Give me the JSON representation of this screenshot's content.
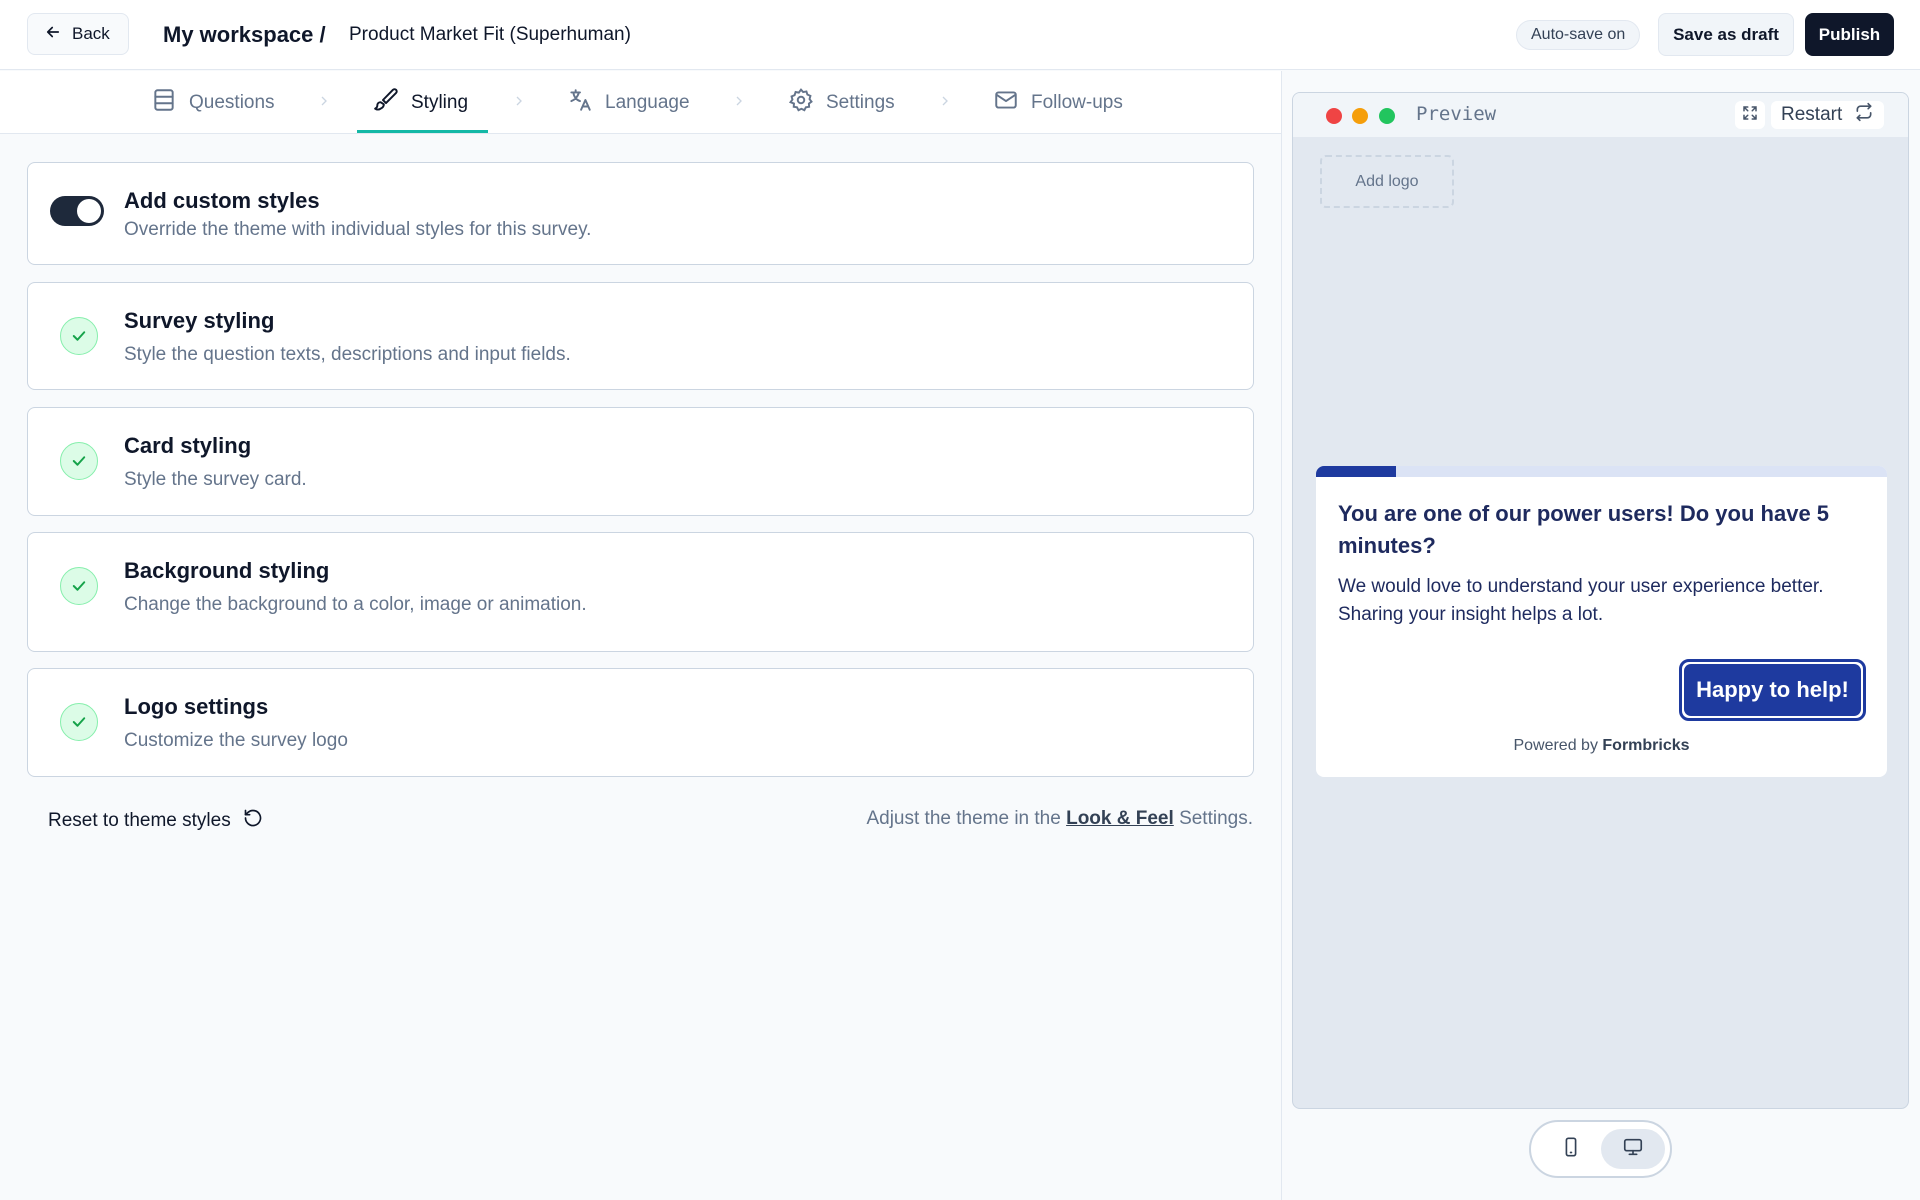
{
  "header": {
    "back_label": "Back",
    "workspace": "My workspace /",
    "survey_name": "Product Market Fit (Superhuman)",
    "autosave": "Auto-save on",
    "save_draft": "Save as draft",
    "publish": "Publish"
  },
  "tabs": [
    {
      "label": "Questions",
      "icon": "questions-icon",
      "active": false
    },
    {
      "label": "Styling",
      "icon": "paintbrush-icon",
      "active": true
    },
    {
      "label": "Language",
      "icon": "language-icon",
      "active": false
    },
    {
      "label": "Settings",
      "icon": "gear-icon",
      "active": false
    },
    {
      "label": "Follow-ups",
      "icon": "mail-icon",
      "active": false
    }
  ],
  "custom_styles": {
    "title": "Add custom styles",
    "desc": "Override the theme with individual styles for this survey.",
    "enabled": true
  },
  "sections": [
    {
      "title": "Survey styling",
      "desc": "Style the question texts, descriptions and input fields."
    },
    {
      "title": "Card styling",
      "desc": "Style the survey card."
    },
    {
      "title": "Background styling",
      "desc": "Change the background to a color, image or animation."
    },
    {
      "title": "Logo settings",
      "desc": "Customize the survey logo"
    }
  ],
  "footer": {
    "reset": "Reset to theme styles",
    "adjust_prefix": "Adjust the theme in the",
    "adjust_link": "Look & Feel",
    "adjust_suffix": "Settings."
  },
  "preview": {
    "label": "Preview",
    "restart": "Restart",
    "add_logo": "Add logo",
    "question": "You are one of our power users! Do you have 5 minutes?",
    "description": "We would love to understand your user experience better. Sharing your insight helps a lot.",
    "button": "Happy to help!",
    "powered_prefix": "Powered by",
    "powered_brand": "Formbricks",
    "progress": 0.14
  },
  "colors": {
    "accent": "#14b8a6",
    "brand": "#1e3a9f",
    "dark": "#0f172a"
  }
}
